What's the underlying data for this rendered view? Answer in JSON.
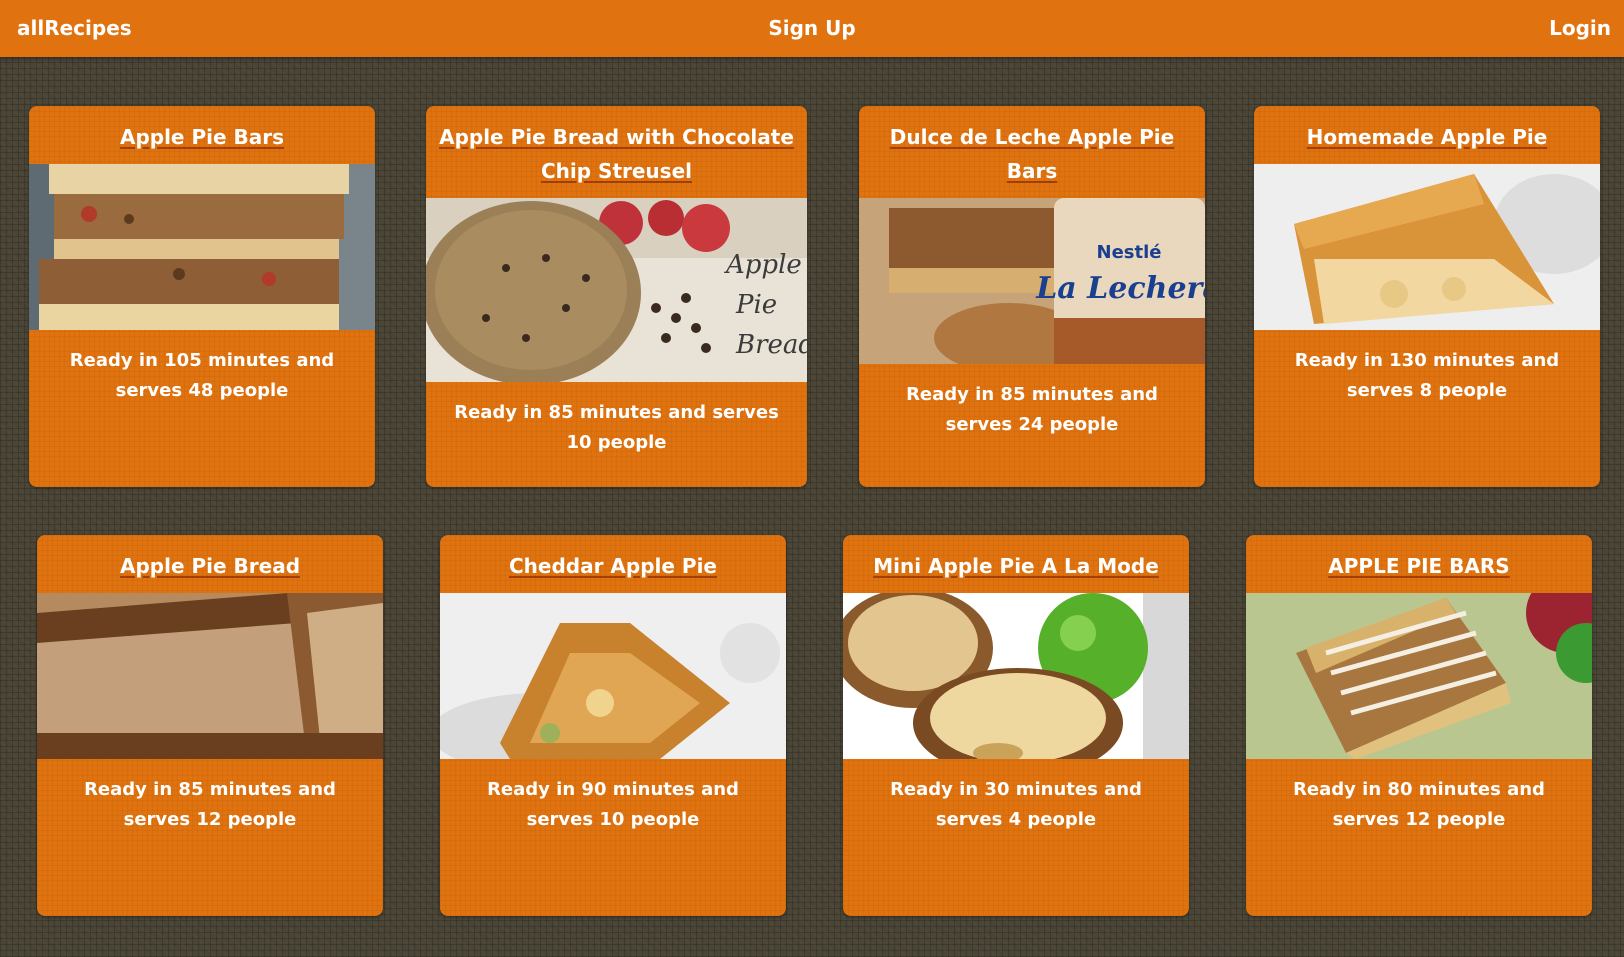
{
  "nav": {
    "brand": "allRecipes",
    "signup": "Sign Up",
    "login": "Login"
  },
  "recipes": [
    {
      "title": "Apple Pie Bars",
      "description": "Ready in 105 minutes and serves 48 people"
    },
    {
      "title": "Apple Pie Bread with Chocolate Chip Streusel",
      "description": "Ready in 85 minutes and serves 10 people",
      "image_text": [
        "Apple",
        "Pie",
        "Bread"
      ]
    },
    {
      "title": "Dulce de Leche Apple Pie Bars",
      "description": "Ready in 85 minutes and serves 24 people",
      "image_text": [
        "Nestlé",
        "La Lechera"
      ]
    },
    {
      "title": "Homemade Apple Pie",
      "description": "Ready in 130 minutes and serves 8 people"
    },
    {
      "title": "Apple Pie Bread",
      "description": "Ready in 85 minutes and serves 12 people"
    },
    {
      "title": "Cheddar Apple Pie",
      "description": "Ready in 90 minutes and serves 10 people"
    },
    {
      "title": "Mini Apple Pie A La Mode",
      "description": "Ready in 30 minutes and serves 4 people"
    },
    {
      "title": "APPLE PIE BARS",
      "description": "Ready in 80 minutes and serves 12 people"
    }
  ],
  "colors": {
    "primary": "#e0730f",
    "background": "#4a4537",
    "text": "#ffffff"
  }
}
